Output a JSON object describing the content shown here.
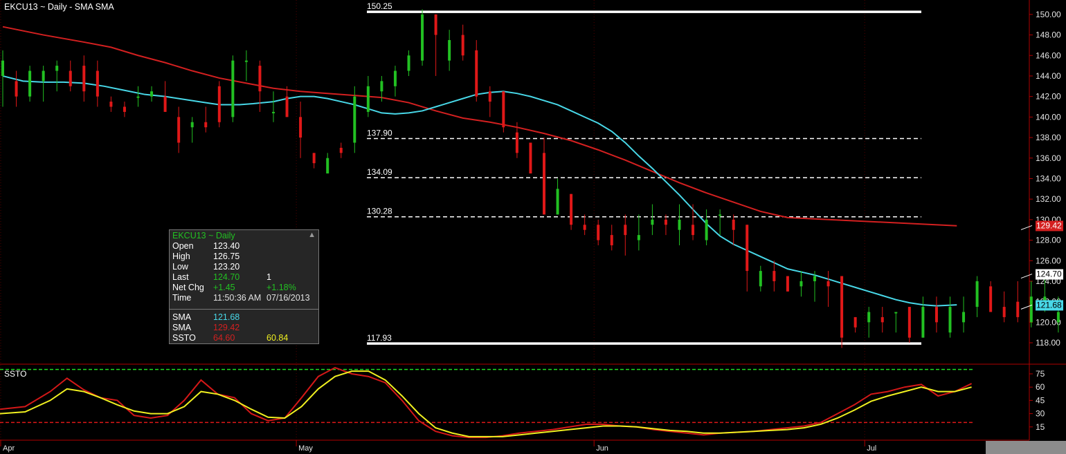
{
  "header": {
    "title": "EKCU13 ~ Daily  -  SMA SMA",
    "ssto_label": "SSTO"
  },
  "chart_data": [
    {
      "type": "candlestick",
      "title": "EKCU13 ~ Daily  -  SMA SMA",
      "ylim": [
        116.8,
        151.0
      ],
      "y_ticks": [
        118.0,
        120.0,
        122.0,
        124.0,
        126.0,
        128.0,
        130.0,
        132.0,
        134.0,
        136.0,
        138.0,
        140.0,
        142.0,
        144.0,
        146.0,
        148.0,
        150.0
      ],
      "y_tick_labels": [
        "118.00",
        "120.00",
        "122.00",
        "124.00",
        "126.00",
        "128.00",
        "130.00",
        "132.00",
        "134.00",
        "136.00",
        "138.00",
        "140.00",
        "142.00",
        "144.00",
        "146.00",
        "148.00",
        "150.00"
      ],
      "x_labels": [
        "Apr",
        "May",
        "Jun",
        "Jul"
      ],
      "x_label_bar_index": [
        0,
        22,
        44,
        64
      ],
      "colors": {
        "up": "#22c022",
        "down": "#e01818",
        "sma_fast": "#48d8e8",
        "sma_slow": "#d42020",
        "fib": "#ffffff",
        "ssto_k": "#d41818",
        "ssto_d": "#f0f020",
        "overbought": "#22dd22",
        "oversold": "#e01818"
      },
      "ohlc": [
        [
          144.0,
          146.5,
          141.0,
          145.5
        ],
        [
          143.5,
          144.5,
          141.0,
          142.0
        ],
        [
          142.0,
          145.0,
          141.5,
          144.5
        ],
        [
          143.5,
          145.0,
          141.5,
          144.5
        ],
        [
          144.5,
          145.5,
          142.5,
          145.0
        ],
        [
          144.5,
          145.5,
          142.5,
          143.0
        ],
        [
          145.0,
          146.0,
          141.5,
          142.5
        ],
        [
          144.5,
          145.5,
          141.0,
          142.0
        ],
        [
          141.5,
          142.0,
          140.5,
          141.0
        ],
        [
          141.0,
          141.5,
          140.0,
          140.5
        ],
        [
          142.0,
          143.0,
          141.0,
          142.0
        ],
        [
          142.0,
          143.0,
          141.5,
          142.5
        ],
        [
          142.0,
          143.5,
          141.0,
          140.5
        ],
        [
          140.0,
          141.0,
          136.5,
          137.5
        ],
        [
          139.0,
          140.0,
          137.5,
          139.5
        ],
        [
          139.5,
          141.0,
          138.5,
          139.0
        ],
        [
          143.0,
          143.5,
          139.0,
          139.5
        ],
        [
          140.0,
          146.0,
          139.5,
          145.5
        ],
        [
          145.5,
          146.5,
          143.5,
          145.5
        ],
        [
          145.0,
          145.5,
          140.5,
          142.5
        ],
        [
          140.5,
          142.5,
          139.5,
          140.5
        ],
        [
          142.0,
          143.0,
          140.0,
          140.0
        ],
        [
          140.0,
          141.5,
          136.0,
          138.0
        ],
        [
          136.5,
          136.0,
          135.0,
          135.5
        ],
        [
          134.5,
          136.5,
          134.5,
          136.0
        ],
        [
          137.0,
          137.5,
          136.0,
          136.5
        ],
        [
          137.5,
          143.0,
          136.5,
          142.0
        ],
        [
          140.5,
          144.0,
          140.0,
          143.0
        ],
        [
          142.5,
          144.0,
          141.5,
          143.5
        ],
        [
          143.0,
          145.0,
          142.0,
          144.5
        ],
        [
          144.5,
          146.5,
          144.0,
          146.0
        ],
        [
          145.5,
          150.5,
          145.0,
          150.0
        ],
        [
          150.0,
          149.5,
          144.0,
          148.0
        ],
        [
          145.5,
          148.5,
          144.5,
          147.5
        ],
        [
          148.0,
          149.0,
          145.5,
          146.0
        ],
        [
          146.5,
          147.5,
          141.5,
          142.0
        ],
        [
          142.5,
          143.0,
          140.0,
          141.5
        ],
        [
          142.5,
          142.0,
          138.5,
          139.0
        ],
        [
          138.5,
          139.5,
          136.0,
          136.5
        ],
        [
          137.5,
          137.5,
          134.5,
          134.5
        ],
        [
          136.5,
          138.0,
          130.5,
          130.5
        ],
        [
          130.5,
          134.0,
          130.5,
          133.0
        ],
        [
          132.5,
          132.5,
          129.0,
          129.5
        ],
        [
          129.5,
          130.5,
          128.5,
          129.0
        ],
        [
          129.5,
          130.0,
          127.5,
          128.0
        ],
        [
          128.5,
          129.5,
          127.0,
          127.5
        ],
        [
          129.5,
          130.5,
          126.5,
          128.5
        ],
        [
          128.0,
          130.5,
          127.0,
          128.5
        ],
        [
          129.5,
          131.5,
          128.5,
          130.0
        ],
        [
          130.0,
          130.5,
          128.5,
          129.5
        ],
        [
          129.0,
          131.5,
          127.5,
          130.0
        ],
        [
          129.5,
          131.5,
          128.0,
          128.5
        ],
        [
          128.0,
          131.0,
          127.5,
          130.0
        ],
        [
          130.5,
          131.0,
          128.5,
          130.5
        ],
        [
          130.0,
          130.5,
          127.5,
          129.0
        ],
        [
          129.5,
          129.5,
          123.0,
          125.0
        ],
        [
          123.5,
          125.5,
          123.0,
          125.0
        ],
        [
          125.0,
          126.0,
          123.0,
          124.0
        ],
        [
          124.5,
          124.5,
          123.0,
          123.0
        ],
        [
          123.5,
          125.0,
          122.5,
          124.0
        ],
        [
          124.0,
          125.0,
          122.0,
          124.5
        ],
        [
          124.0,
          125.0,
          121.5,
          123.5
        ],
        [
          124.5,
          124.5,
          117.5,
          118.5
        ],
        [
          120.5,
          120.0,
          119.0,
          119.5
        ],
        [
          120.0,
          121.5,
          118.5,
          121.0
        ],
        [
          120.5,
          121.5,
          119.0,
          120.0
        ],
        [
          121.0,
          120.5,
          119.0,
          121.0
        ],
        [
          121.5,
          121.0,
          118.0,
          118.5
        ],
        [
          118.5,
          122.5,
          118.5,
          121.5
        ],
        [
          121.5,
          122.5,
          119.0,
          120.0
        ],
        [
          119.0,
          122.5,
          118.5,
          121.5
        ],
        [
          120.0,
          122.5,
          119.0,
          121.0
        ],
        [
          121.5,
          124.5,
          120.5,
          124.0
        ],
        [
          123.5,
          124.0,
          121.0,
          121.0
        ],
        [
          121.5,
          123.0,
          120.0,
          120.5
        ],
        [
          122.0,
          124.0,
          120.0,
          120.5
        ],
        [
          120.0,
          124.0,
          119.5,
          122.5
        ],
        [
          122.0,
          124.5,
          121.0,
          122.5
        ],
        [
          120.0,
          122.5,
          119.0,
          121.0
        ],
        [
          124.0,
          124.0,
          119.0,
          123.5
        ],
        [
          123.5,
          124.0,
          119.0,
          119.0
        ],
        [
          119.0,
          124.0,
          118.5,
          123.5
        ],
        [
          123.0,
          126.75,
          123.2,
          124.7
        ]
      ],
      "sma_fast": [
        144.0,
        143.5,
        143.4,
        143.4,
        143.3,
        143.0,
        142.6,
        142.2,
        142.0,
        141.8,
        141.5,
        141.2,
        141.2,
        141.3,
        141.5,
        141.8,
        142.0,
        142.0,
        141.8,
        141.5,
        141.2,
        140.8,
        140.4,
        140.3,
        140.4,
        140.6,
        141.0,
        141.4,
        141.8,
        142.2,
        142.4,
        142.5,
        142.3,
        142.0,
        141.6,
        141.2,
        140.6,
        140.0,
        139.4,
        138.6,
        137.5,
        136.2,
        135.0,
        133.7,
        132.4,
        131.0,
        129.6,
        128.4,
        127.6,
        127.0,
        126.4,
        125.8,
        125.2,
        124.9,
        124.6,
        124.2,
        123.8,
        123.4,
        123.0,
        122.6,
        122.2,
        121.9,
        121.7,
        121.6,
        121.7
      ],
      "sma_fast_x": [
        0,
        1.5,
        3,
        4.5,
        6,
        7.5,
        9,
        10.5,
        12,
        13,
        14.5,
        16,
        17.5,
        18.5,
        20,
        21,
        22,
        23,
        24,
        25,
        26,
        27,
        28,
        29,
        30,
        31,
        32,
        33,
        34,
        35,
        36,
        37,
        38,
        39,
        40,
        41,
        42,
        43,
        44,
        45,
        46,
        47,
        48,
        49,
        50,
        51,
        52,
        53,
        54,
        55,
        56,
        57,
        58,
        59,
        60,
        61,
        62,
        63,
        64,
        65,
        66,
        67,
        68,
        69,
        70.5
      ],
      "sma_slow": [
        148.8,
        148.0,
        147.3,
        146.8,
        146.0,
        145.3,
        144.5,
        143.8,
        143.3,
        142.8,
        142.5,
        142.3,
        142.1,
        141.9,
        141.4,
        140.6,
        139.9,
        139.5,
        139.0,
        138.4,
        137.7,
        136.8,
        135.8,
        134.7,
        133.6,
        132.6,
        131.7,
        130.8,
        130.2,
        129.4
      ],
      "sma_slow_x": [
        0,
        3,
        6,
        8,
        10,
        12,
        14,
        16,
        18,
        20,
        22,
        24,
        26,
        28,
        30,
        32,
        34,
        36,
        38,
        40,
        42,
        44,
        46,
        48,
        50,
        52,
        54,
        56,
        58,
        70.5
      ],
      "fib_levels": [
        {
          "value": 150.25,
          "label": "150.25",
          "style": "solid"
        },
        {
          "value": 137.9,
          "label": "137.90",
          "style": "dashed"
        },
        {
          "value": 134.09,
          "label": "134.09",
          "style": "dashed"
        },
        {
          "value": 130.28,
          "label": "130.28",
          "style": "dashed"
        },
        {
          "value": 117.93,
          "label": "117.93",
          "style": "solid"
        }
      ],
      "price_badges": [
        {
          "value": 129.42,
          "label": "129.42",
          "bg": "#d42020",
          "fg": "#ffffff"
        },
        {
          "value": 124.7,
          "label": "124.70",
          "bg": "#ffffff",
          "fg": "#000000"
        },
        {
          "value": 121.68,
          "label": "121.68",
          "bg": "#48d8e8",
          "fg": "#000000"
        }
      ]
    },
    {
      "type": "line",
      "title": "SSTO",
      "ylim": [
        0,
        100
      ],
      "y_ticks": [
        15,
        30,
        45,
        60,
        75
      ],
      "y_tick_labels": [
        "15",
        "30",
        "45",
        "60",
        "75"
      ],
      "overbought": 80,
      "oversold": 20,
      "series": [
        {
          "name": "",
          "color": "#d41818",
          "values": [
            35,
            38,
            55,
            70,
            57,
            48,
            45,
            28,
            25,
            28,
            45,
            68,
            52,
            48,
            30,
            22,
            25,
            48,
            72,
            82,
            75,
            72,
            65,
            45,
            22,
            10,
            5,
            3,
            3,
            5,
            8,
            10,
            12,
            15,
            18,
            18,
            16,
            15,
            12,
            10,
            8,
            6,
            8,
            9,
            10,
            12,
            14,
            16,
            20,
            30,
            40,
            52,
            55,
            60,
            63,
            50,
            55,
            64
          ]
        },
        {
          "name": "",
          "color": "#f0f020",
          "values": [
            30,
            32,
            45,
            58,
            55,
            48,
            40,
            33,
            30,
            30,
            38,
            55,
            52,
            45,
            35,
            26,
            25,
            38,
            58,
            72,
            78,
            78,
            68,
            50,
            30,
            14,
            8,
            4,
            4,
            4,
            6,
            8,
            10,
            12,
            14,
            16,
            16,
            15,
            13,
            11,
            10,
            8,
            8,
            9,
            10,
            11,
            12,
            14,
            18,
            25,
            34,
            44,
            50,
            55,
            60,
            55,
            55,
            60
          ]
        }
      ],
      "x": [
        0,
        3,
        6,
        8,
        10,
        12,
        14,
        16,
        18,
        20,
        22,
        24,
        26,
        28,
        30,
        32,
        34,
        36,
        38,
        40,
        42,
        44,
        46,
        48,
        50,
        52,
        54,
        56,
        58,
        60,
        62,
        64,
        66,
        68,
        70,
        72,
        74,
        76,
        78,
        80,
        82,
        84,
        86,
        88,
        90,
        92,
        94,
        96,
        98,
        100,
        102,
        104,
        106,
        108,
        110,
        112,
        114,
        116
      ]
    }
  ],
  "infobox": {
    "symbol": "EKCU13 ~ Daily",
    "close_icon": "x-icon",
    "rows": [
      {
        "k": "Open",
        "v1": "123.40",
        "v2": "",
        "c1": "#ffffff",
        "c2": "#ffffff"
      },
      {
        "k": "High",
        "v1": "126.75",
        "v2": "",
        "c1": "#ffffff",
        "c2": "#ffffff"
      },
      {
        "k": "Low",
        "v1": "123.20",
        "v2": "",
        "c1": "#ffffff",
        "c2": "#ffffff"
      },
      {
        "k": "Last",
        "v1": "124.70",
        "v2": "1",
        "c1": "#22c022",
        "c2": "#ffffff"
      },
      {
        "k": "Net Chg",
        "v1": "+1.45",
        "v2": "+1.18%",
        "c1": "#22c022",
        "c2": "#22c022"
      },
      {
        "k": "Time",
        "v1": "11:50:36 AM",
        "v2": "07/16/2013",
        "c1": "#e0e0e0",
        "c2": "#e0e0e0"
      }
    ],
    "studies": [
      {
        "k": "SMA",
        "v1": "121.68",
        "v2": "",
        "c1": "#48d8e8",
        "c2": "#ffffff"
      },
      {
        "k": "SMA",
        "v1": "129.42",
        "v2": "",
        "c1": "#d42020",
        "c2": "#ffffff"
      },
      {
        "k": "SSTO",
        "v1": "64.60",
        "v2": "60.84",
        "c1": "#d42020",
        "c2": "#f0f020"
      }
    ]
  }
}
